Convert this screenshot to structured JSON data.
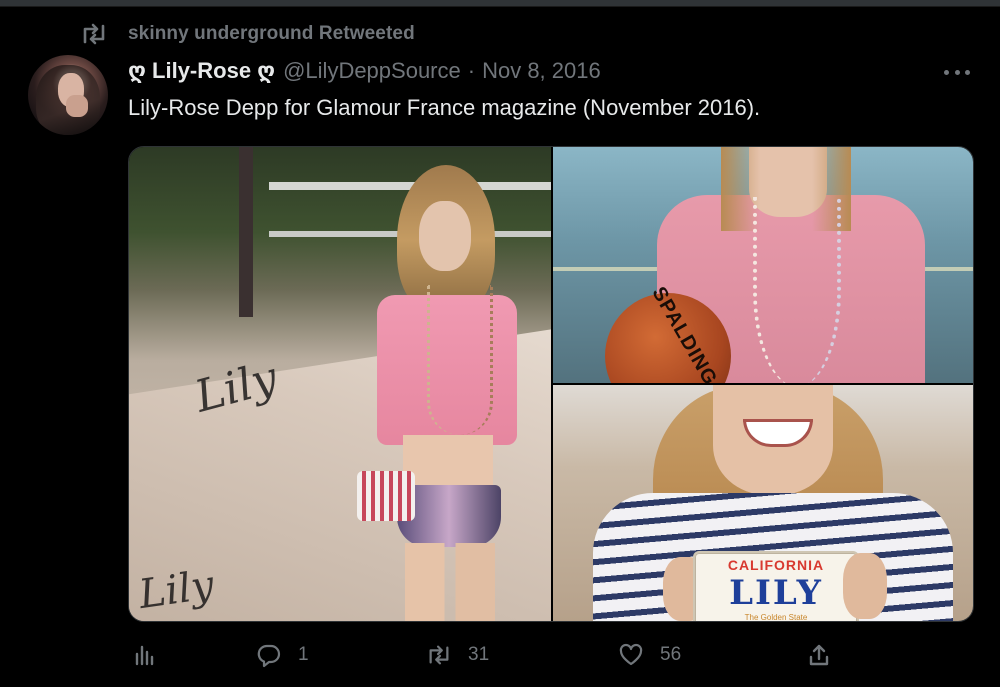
{
  "retweet": {
    "label": "skinny underground Retweeted",
    "icon": "retweet-icon"
  },
  "author": {
    "display_name": "ღ Lily-Rose ღ",
    "handle": "@LilyDeppSource",
    "separator": "·",
    "date": "Nov 8, 2016"
  },
  "tweet": {
    "text": "Lily-Rose Depp for Glamour France magazine (November 2016)."
  },
  "media": {
    "ball_text": "SPALDING",
    "plate": {
      "top": "CALIFORNIA",
      "main": "LILY",
      "bottom": "The Golden State"
    },
    "graffiti": [
      "Lily",
      "Lily"
    ]
  },
  "actions": {
    "analytics": {
      "icon": "analytics-icon"
    },
    "reply": {
      "icon": "reply-icon",
      "count": "1"
    },
    "retweet": {
      "icon": "retweet-icon",
      "count": "31"
    },
    "like": {
      "icon": "heart-icon",
      "count": "56"
    },
    "share": {
      "icon": "share-icon"
    }
  },
  "colors": {
    "background": "#000000",
    "text_primary": "#e7e9ea",
    "text_secondary": "#71767b",
    "border": "#2f3336"
  }
}
